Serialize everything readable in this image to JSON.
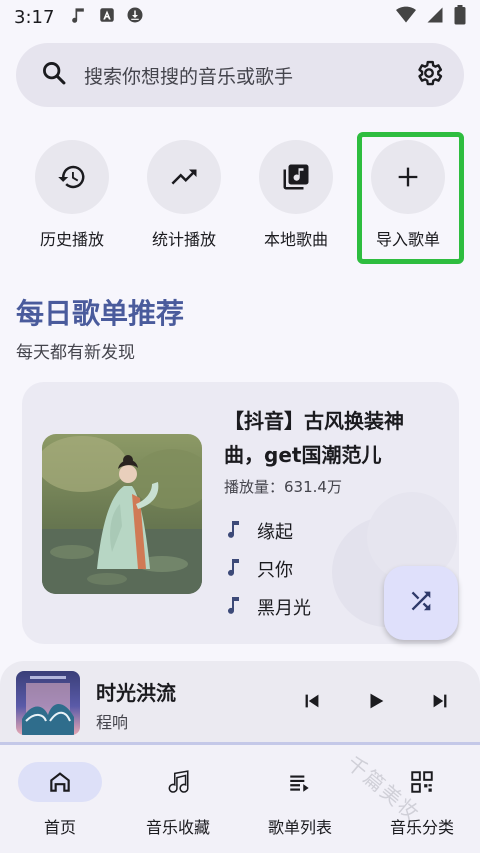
{
  "status_bar": {
    "time": "3:17"
  },
  "search": {
    "placeholder": "搜索你想搜的音乐或歌手"
  },
  "quick_actions": [
    {
      "label": "历史播放",
      "icon": "history-icon"
    },
    {
      "label": "统计播放",
      "icon": "trending-icon"
    },
    {
      "label": "本地歌曲",
      "icon": "library-music-icon"
    },
    {
      "label": "导入歌单",
      "icon": "plus-icon"
    }
  ],
  "daily": {
    "title": "每日歌单推荐",
    "subtitle": "每天都有新发现",
    "playlist": {
      "title": "【抖音】古风换装神曲，get国潮范儿",
      "plays": "播放量：631.4万",
      "songs": [
        "缘起",
        "只你",
        "黑月光"
      ]
    }
  },
  "player": {
    "title": "时光洪流",
    "artist": "程响",
    "progress": 0.0
  },
  "nav": [
    {
      "label": "首页",
      "icon": "home-icon",
      "active": true
    },
    {
      "label": "音乐收藏",
      "icon": "music-note-icon",
      "active": false
    },
    {
      "label": "歌单列表",
      "icon": "playlist-icon",
      "active": false
    },
    {
      "label": "音乐分类",
      "icon": "grid-icon",
      "active": false
    }
  ],
  "watermark": "千篇美妆",
  "colors": {
    "accent": "#4a5b9c",
    "highlight_border": "#2ebd3f"
  }
}
